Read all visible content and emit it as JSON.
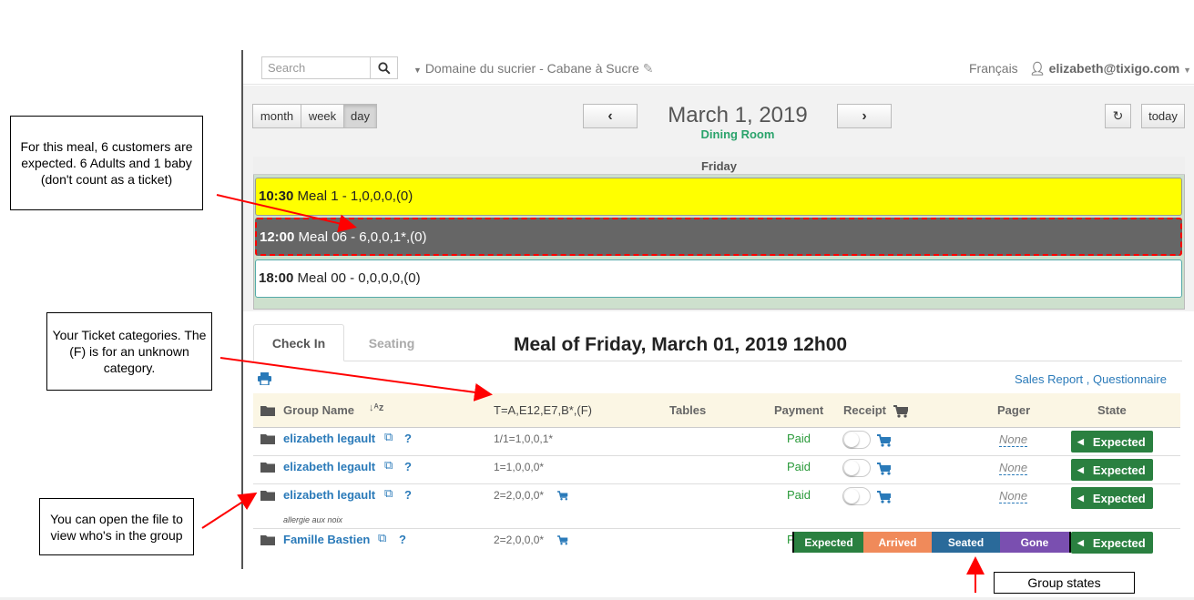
{
  "topbar": {
    "search_placeholder": "Search",
    "venue": "Domaine du sucrier - Cabane à Sucre",
    "language": "Français",
    "user": "elizabeth@tixigo.com"
  },
  "calendar": {
    "views": [
      "month",
      "week",
      "day"
    ],
    "active_view": "day",
    "date": "March 1, 2019",
    "room": "Dining Room",
    "today_label": "today",
    "day_name": "Friday",
    "meals": [
      {
        "time": "10:30",
        "label": "Meal 1 - 1,0,0,0,(0)",
        "color": "#ffff00"
      },
      {
        "time": "12:00",
        "label": "Meal 06 - 6,0,0,1*,(0)",
        "color": "#666666"
      },
      {
        "time": "18:00",
        "label": "Meal 00 - 0,0,0,0,(0)",
        "color": "#ffffff"
      }
    ]
  },
  "tabs": [
    "Check In",
    "Seating"
  ],
  "meal_title": "Meal of Friday, March 01, 2019 12h00",
  "links": {
    "sales_report": "Sales Report",
    "separator": ",",
    "questionnaire": "Questionnaire"
  },
  "table": {
    "headers": {
      "group_name": "Group Name",
      "tickets": "T=A,E12,E7,B*,(F)",
      "tables": "Tables",
      "payment": "Payment",
      "receipt": "Receipt",
      "pager": "Pager",
      "state": "State"
    },
    "rows": [
      {
        "name": "elizabeth legault",
        "tickets": "1/1=1,0,0,1*",
        "payment": "Paid",
        "pager": "None",
        "state": "Expected",
        "note": ""
      },
      {
        "name": "elizabeth legault",
        "tickets": "1=1,0,0,0*",
        "payment": "Paid",
        "pager": "None",
        "state": "Expected",
        "note": ""
      },
      {
        "name": "elizabeth legault",
        "tickets": "2=2,0,0,0*",
        "payment": "Paid",
        "pager": "None",
        "state": "Expected",
        "note": "allergie aux noix"
      },
      {
        "name": "Famille Bastien",
        "tickets": "2=2,0,0,0*",
        "payment": "P",
        "pager": "",
        "state": "Expected",
        "note": ""
      }
    ],
    "q_mark": "?"
  },
  "state_options": [
    {
      "label": "Expected",
      "color": "#2a8040"
    },
    {
      "label": "Arrived",
      "color": "#f08a5a"
    },
    {
      "label": "Seated",
      "color": "#2a6a9a"
    },
    {
      "label": "Gone",
      "color": "#7a4fb0"
    }
  ],
  "callouts": {
    "meal_expected": "For this meal, 6 customers are expected. 6 Adults and 1 baby (don't count as a ticket)",
    "ticket_categories": "Your Ticket categories. The (F) is for an unknown category.",
    "open_file": "You can open the file to view who's in the group",
    "group_states": "Group states"
  },
  "colors": {
    "accent_blue": "#2a7ab9",
    "expected_green": "#2a8040",
    "annotation_red": "#ff0000"
  }
}
